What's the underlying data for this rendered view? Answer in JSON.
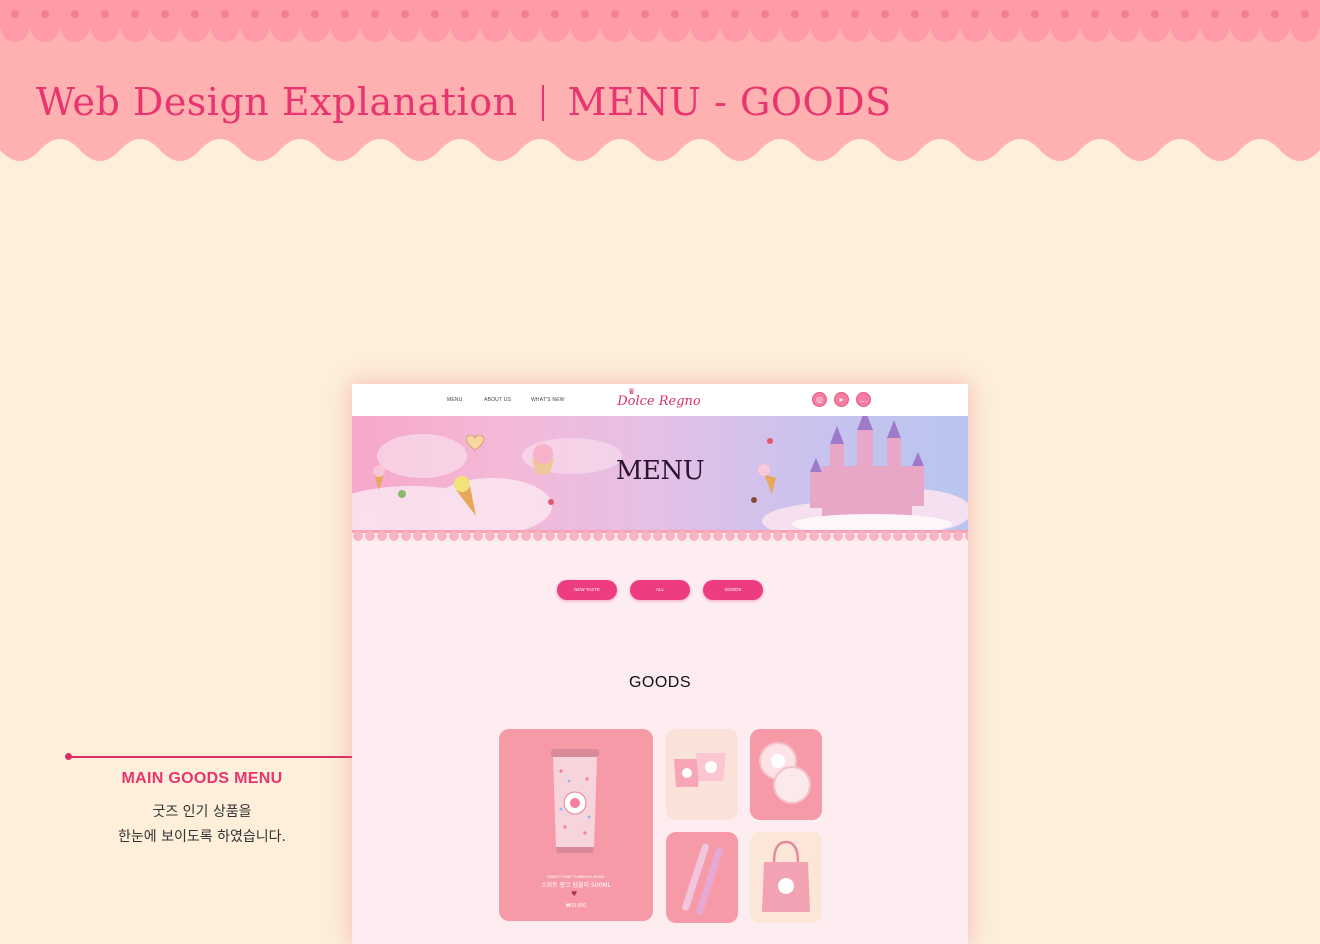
{
  "header": {
    "title_left": "Web Design Explanation",
    "title_right": "MENU - GOODS"
  },
  "annotation": {
    "title": "MAIN GOODS MENU",
    "lines": [
      "굿즈 인기 상품을",
      "한눈에 보이도록 하였습니다."
    ]
  },
  "mockup": {
    "nav": {
      "items": [
        "MENU",
        "ABOUT US",
        "WHAT'S NEW"
      ],
      "logo": "Dolce Regno",
      "social_icons": [
        "instagram-icon",
        "youtube-icon",
        "chat-icon"
      ]
    },
    "hero_title": "MENU",
    "category_buttons": [
      "NEW TASTE",
      "ALL",
      "GOODS"
    ],
    "section_title": "GOODS",
    "main_product": {
      "subtitle": "SWEET PINK TUMBLER 500ML",
      "name": "스위트 핑크 텀블러 500ML",
      "price": "₩15,000"
    }
  },
  "colors": {
    "banner": "#ffb0b0",
    "accent": "#e8356f",
    "background": "#fdefd9",
    "button": "#ee3c82"
  }
}
